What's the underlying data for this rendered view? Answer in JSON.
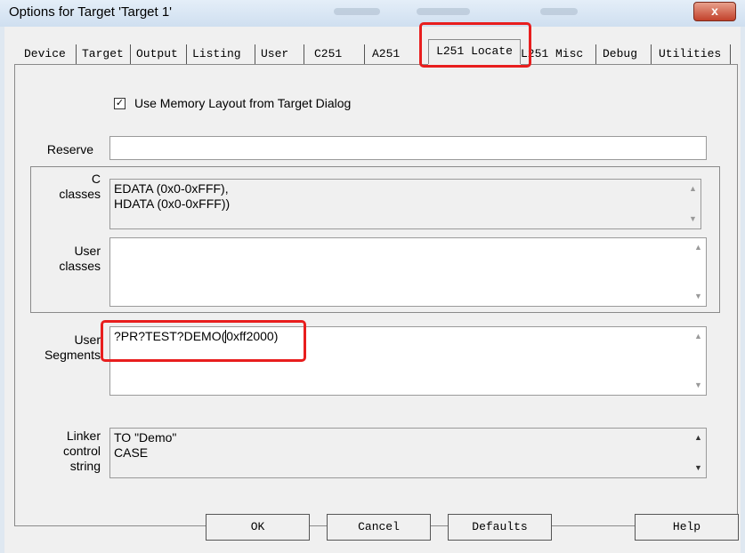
{
  "window": {
    "title": "Options for Target 'Target 1'",
    "close_label": "x"
  },
  "tabs": [
    {
      "label": "Device"
    },
    {
      "label": "Target"
    },
    {
      "label": "Output"
    },
    {
      "label": "Listing"
    },
    {
      "label": "User"
    },
    {
      "label": "C251"
    },
    {
      "label": "A251"
    },
    {
      "label": "L251 Locate",
      "active": true
    },
    {
      "label": "L251 Misc"
    },
    {
      "label": "Debug"
    },
    {
      "label": "Utilities"
    }
  ],
  "use_memory_layout": {
    "label": "Use Memory Layout from Target Dialog",
    "checked": true
  },
  "reserve": {
    "label": "Reserve",
    "value": ""
  },
  "c_classes": {
    "label_1": "C",
    "label_2": "classes",
    "value_1": "EDATA (0x0-0xFFF),",
    "value_2": "HDATA (0x0-0xFFF))"
  },
  "user_classes": {
    "label_1": "User",
    "label_2": "classes",
    "value": ""
  },
  "user_segments": {
    "label_1": "User",
    "label_2": "Segments",
    "value_before_caret": "?PR?TEST?DEMO(",
    "value_after_caret": "0xff2000)"
  },
  "linker_control": {
    "label_1": "Linker",
    "label_2": "control",
    "label_3": "string",
    "value_1": "TO \"Demo\"",
    "value_2": "CASE"
  },
  "buttons": {
    "ok": "OK",
    "cancel": "Cancel",
    "defaults": "Defaults",
    "help": "Help"
  },
  "colors": {
    "highlight": "#e81e1e",
    "titlebar": "#dbe6f2",
    "close": "#c94a35"
  },
  "icons": {
    "check": "check-icon",
    "scroll_up": "arrow-up-icon",
    "scroll_down": "arrow-down-icon",
    "close": "close-icon"
  }
}
